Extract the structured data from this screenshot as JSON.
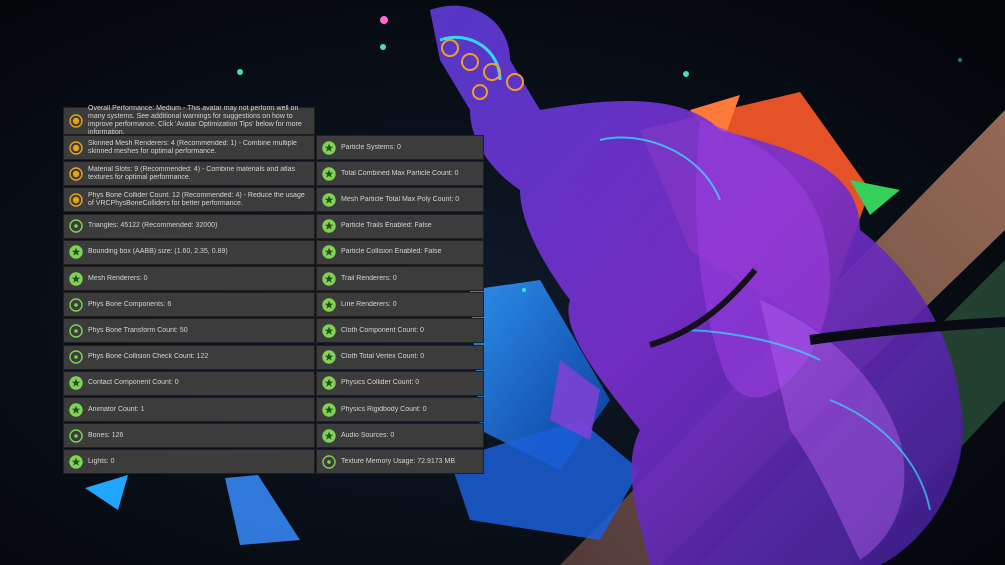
{
  "colors": {
    "panel_bg": "#3c3c3c",
    "text": "#d4d4d4",
    "medium": "#e8a319",
    "excellent": "#7fd452",
    "good": "#7fd452"
  },
  "overall": {
    "text": "Overall Performance: Medium - This avatar may not perform well on many systems. See additional warnings for suggestions on how to improve performance. Click 'Avatar Optimization Tips' below for more information.",
    "icon": "medium-rating-icon"
  },
  "stats_left": [
    {
      "text": "Skinned Mesh Renderers: 4 (Recommended: 1) - Combine multiple skinned meshes for optimal performance.",
      "rating": "medium"
    },
    {
      "text": "Material Slots: 9 (Recommended: 4) - Combine materials and atlas textures for optimal performance.",
      "rating": "medium"
    },
    {
      "text": "Phys Bone Collider Count: 12 (Recommended: 4) - Reduce the usage of VRCPhysBoneColliders for better performance.",
      "rating": "medium"
    },
    {
      "text": "Triangles: 45122 (Recommended: 32000)",
      "rating": "good"
    },
    {
      "text": "Bounding box (AABB) size: (1.60, 2.35, 0.89)",
      "rating": "excellent"
    },
    {
      "text": "Mesh Renderers: 0",
      "rating": "excellent"
    },
    {
      "text": "Phys Bone Components: 6",
      "rating": "good"
    },
    {
      "text": "Phys Bone Transform Count: 50",
      "rating": "good"
    },
    {
      "text": "Phys Bone Collision Check Count: 122",
      "rating": "good"
    },
    {
      "text": "Contact Component Count: 0",
      "rating": "excellent"
    },
    {
      "text": "Animator Count: 1",
      "rating": "excellent"
    },
    {
      "text": "Bones: 126",
      "rating": "good"
    },
    {
      "text": "Lights: 0",
      "rating": "excellent"
    }
  ],
  "stats_right": [
    {
      "text": "Particle Systems: 0",
      "rating": "excellent"
    },
    {
      "text": "Total Combined Max Particle Count: 0",
      "rating": "excellent"
    },
    {
      "text": "Mesh Particle Total Max Poly Count: 0",
      "rating": "excellent"
    },
    {
      "text": "Particle Trails Enabled: False",
      "rating": "excellent"
    },
    {
      "text": "Particle Collision Enabled: False",
      "rating": "excellent"
    },
    {
      "text": "Trail Renderers: 0",
      "rating": "excellent"
    },
    {
      "text": "Line Renderers: 0",
      "rating": "excellent"
    },
    {
      "text": "Cloth Component Count: 0",
      "rating": "excellent"
    },
    {
      "text": "Cloth Total Vertex Count: 0",
      "rating": "excellent"
    },
    {
      "text": "Physics Collider Count: 0",
      "rating": "excellent"
    },
    {
      "text": "Physics Rigidbody Count: 0",
      "rating": "excellent"
    },
    {
      "text": "Audio Sources: 0",
      "rating": "excellent"
    },
    {
      "text": "Texture Memory Usage: 72.9173 MB",
      "rating": "good"
    }
  ]
}
